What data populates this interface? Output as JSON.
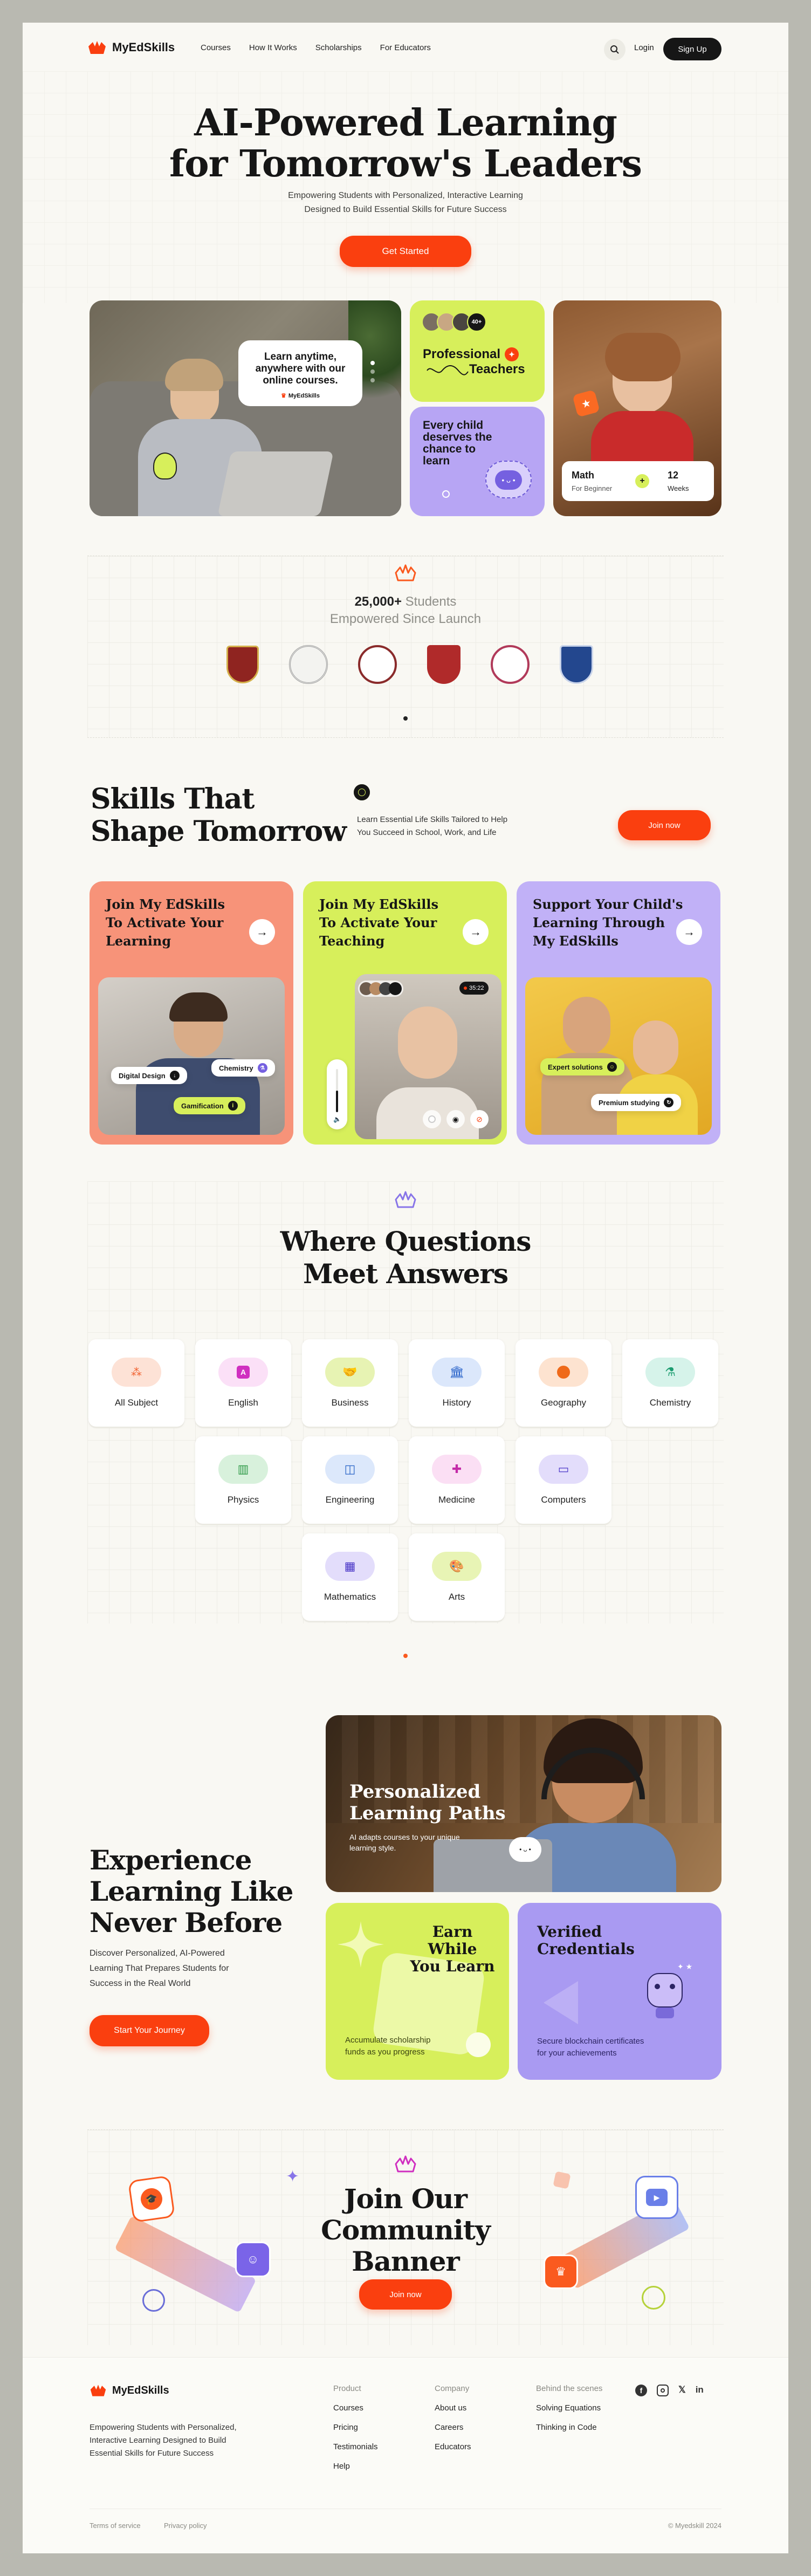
{
  "nav": {
    "brand": "MyEdSkills",
    "links": [
      "Courses",
      "How It Works",
      "Scholarships",
      "For Educators"
    ],
    "login": "Login",
    "signup": "Sign Up"
  },
  "hero": {
    "title_line1": "AI-Powered Learning",
    "title_line2": "for Tomorrow's Leaders",
    "subtitle_line1": "Empowering Students with Personalized, Interactive Learning",
    "subtitle_line2": "Designed to Build Essential Skills for Future Success",
    "cta": "Get Started",
    "bubble_line1": "Learn anytime,",
    "bubble_line2": "anywhere with our",
    "bubble_line3": "online courses.",
    "bubble_brand": "MyEdSkills",
    "teachers_count": "40+",
    "teachers_line1": "Professional",
    "teachers_line2": "Teachers",
    "purple_line1": "Every child",
    "purple_line2": "deserves the",
    "purple_line3": "chance to",
    "purple_line4": "learn",
    "course_title": "Math",
    "course_level": "For Beginner",
    "course_num": "12",
    "course_unit": "Weeks"
  },
  "stats": {
    "count": "25,000+",
    "count_suffix": "Students",
    "line2": "Empowered Since Launch"
  },
  "skills": {
    "title_line1": "Skills That",
    "title_line2": "Shape Tomorrow",
    "desc_line1": "Learn Essential Life Skills Tailored to Help",
    "desc_line2": "You Succeed in School, Work, and Life",
    "cta": "Join now",
    "cards": [
      {
        "line1": "Join  My EdSkills",
        "line2": "To Activate Your",
        "line3": "Learning",
        "color": "#f79379",
        "chips": [
          "Digital Design",
          "Chemistry",
          "Gamification"
        ]
      },
      {
        "line1": "Join My EdSkills",
        "line2": "To Activate Your",
        "line3": "Teaching",
        "color": "#d7ef5b",
        "timer": "35:22"
      },
      {
        "line1": "Support Your Child's",
        "line2": "Learning Through",
        "line3": "My EdSkills",
        "color": "#c1b1f7",
        "chips": [
          "Expert solutions",
          "Premium studying"
        ]
      }
    ]
  },
  "questions": {
    "title_line1": "Where Questions",
    "title_line2": "Meet Answers",
    "subjects": [
      {
        "name": "All Subject",
        "icon": "dots-icon",
        "bg": "#fde2d6",
        "fg": "#f0602e"
      },
      {
        "name": "English",
        "icon": "letter-a-icon",
        "bg": "#fbe0f7",
        "fg": "#d02fc0"
      },
      {
        "name": "Business",
        "icon": "handshake-icon",
        "bg": "#e7f3b3",
        "fg": "#4f6412"
      },
      {
        "name": "History",
        "icon": "building-icon",
        "bg": "#dbe7fb",
        "fg": "#2560c9"
      },
      {
        "name": "Geography",
        "icon": "globe-icon",
        "bg": "#fde3d0",
        "fg": "#ef6a1a"
      },
      {
        "name": "Chemistry",
        "icon": "flask-icon",
        "bg": "#d6f3ea",
        "fg": "#1c9c70"
      },
      {
        "name": "Physics",
        "icon": "atom-icon",
        "bg": "#d8f1dc",
        "fg": "#2f9a48"
      },
      {
        "name": "Engineering",
        "icon": "gear-book-icon",
        "bg": "#dce8fb",
        "fg": "#2a65c7"
      },
      {
        "name": "Medicine",
        "icon": "medkit-icon",
        "bg": "#fbdff4",
        "fg": "#c42aa8"
      },
      {
        "name": "Computers",
        "icon": "monitor-icon",
        "bg": "#e3ddfb",
        "fg": "#4a36c7"
      },
      {
        "name": "Mathematics",
        "icon": "calculator-icon",
        "bg": "#e3ddfb",
        "fg": "#4a36c7"
      },
      {
        "name": "Arts",
        "icon": "palette-icon",
        "bg": "#e8f4b5",
        "fg": "#5a6f12"
      }
    ]
  },
  "experience": {
    "title_line1": "Experience",
    "title_line2": "Learning Like",
    "title_line3": "Never Before",
    "desc_line1": "Discover Personalized, AI-Powered",
    "desc_line2": "Learning That Prepares Students for",
    "desc_line3": "Success in the Real World",
    "cta": "Start Your Journey",
    "personalized_line1": "Personalized",
    "personalized_line2": "Learning Paths",
    "personalized_desc_line1": "AI adapts courses to your unique",
    "personalized_desc_line2": "learning style.",
    "earn_line1": "Earn While",
    "earn_line2": "You Learn",
    "earn_desc_line1": "Accumulate scholarship",
    "earn_desc_line2": "funds as you progress",
    "verified_line1": "Verified",
    "verified_line2": "Credentials",
    "verified_desc_line1": "Secure blockchain certificates",
    "verified_desc_line2": "for your achievements"
  },
  "community": {
    "title_line1": "Join Our",
    "title_line2": "Community",
    "title_line3": "Banner",
    "cta": "Join now"
  },
  "footer": {
    "brand": "MyEdSkills",
    "desc_line1": "Empowering Students with Personalized,",
    "desc_line2": "Interactive Learning Designed to Build",
    "desc_line3": "Essential Skills for Future Success",
    "col1_head": "Product",
    "col1": [
      "Courses",
      "Pricing",
      "Testimonials",
      "Help"
    ],
    "col2_head": "Company",
    "col2": [
      "About us",
      "Careers",
      "Educators"
    ],
    "col3_head": "Behind the scenes",
    "col3": [
      "Solving Equations",
      "Thinking in Code"
    ],
    "terms": "Terms of service",
    "privacy": "Privacy policy",
    "copyright": "© Myedskill 2024"
  },
  "colors": {
    "accent": "#fa3f0f",
    "lime": "#d7ef5b",
    "lavender": "#c1b1f7",
    "salmon": "#f79379"
  }
}
